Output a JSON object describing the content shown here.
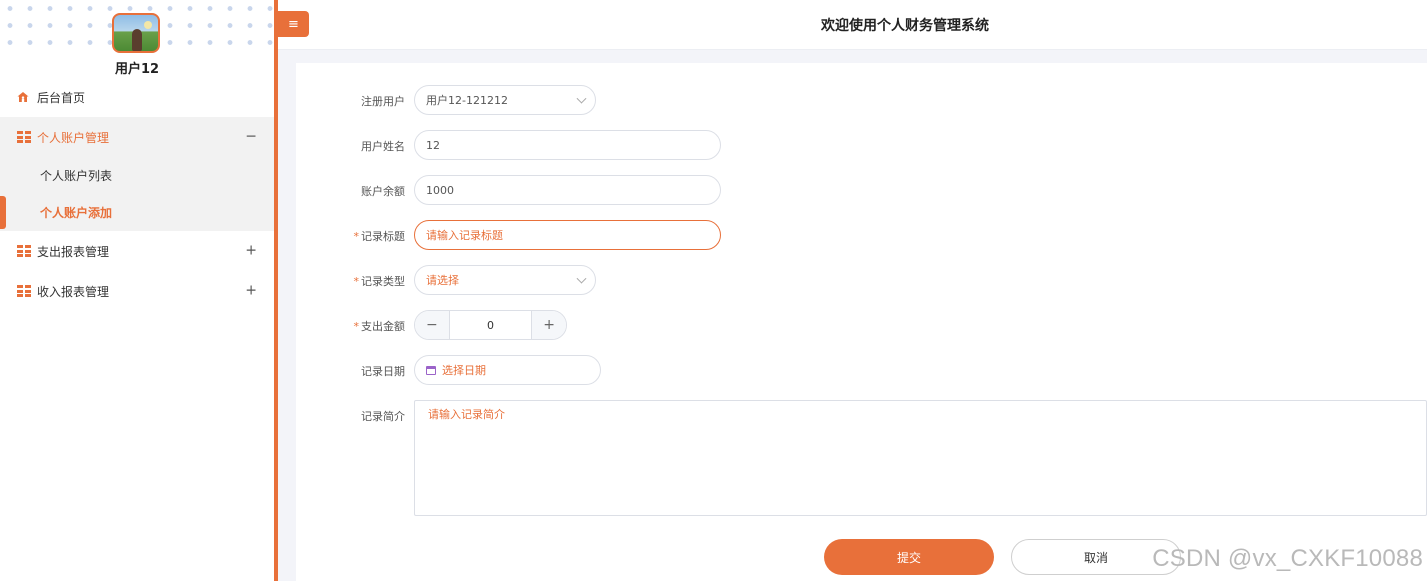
{
  "sidebar": {
    "user_name": "用户12",
    "menu": [
      {
        "label": "后台首页",
        "icon": "home-icon"
      },
      {
        "label": "个人账户管理",
        "icon": "grid-icon",
        "toggle": "−"
      },
      {
        "label": "支出报表管理",
        "icon": "grid-icon",
        "toggle": "+"
      },
      {
        "label": "收入报表管理",
        "icon": "grid-icon",
        "toggle": "+"
      }
    ],
    "sub_items": [
      "个人账户列表",
      "个人账户添加"
    ]
  },
  "header": {
    "menu_icon": "≡",
    "title": "欢迎使用个人财务管理系统"
  },
  "form": {
    "registered_user": {
      "label": "注册用户",
      "value": "用户12-121212"
    },
    "user_name": {
      "label": "用户姓名",
      "value": "12"
    },
    "balance": {
      "label": "账户余额",
      "value": "1000"
    },
    "record_title": {
      "label": "记录标题",
      "placeholder": "请输入记录标题"
    },
    "record_type": {
      "label": "记录类型",
      "placeholder": "请选择"
    },
    "amount": {
      "label": "支出金额",
      "value": "0",
      "minus": "−",
      "plus": "+"
    },
    "record_date": {
      "label": "记录日期",
      "placeholder": "选择日期"
    },
    "record_desc": {
      "label": "记录简介",
      "placeholder": "请输入记录简介"
    },
    "required_mark": "*"
  },
  "actions": {
    "submit": "提交",
    "cancel": "取消"
  },
  "watermark": "CSDN @vx_CXKF10088",
  "colors": {
    "accent": "#e8703a"
  }
}
